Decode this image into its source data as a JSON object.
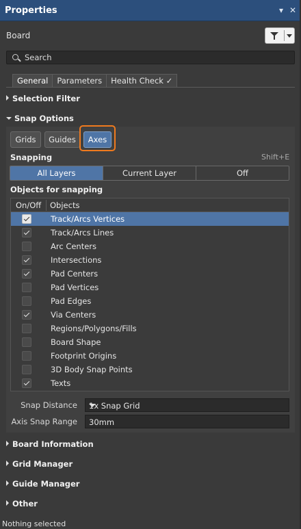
{
  "window": {
    "title": "Properties",
    "pin_glyph": "▾",
    "close_glyph": "✕"
  },
  "header": {
    "object_type": "Board",
    "filter_icon": "funnel-icon"
  },
  "search": {
    "placeholder": "Search",
    "value": ""
  },
  "tabs": [
    {
      "label": "General",
      "active": true
    },
    {
      "label": "Parameters",
      "active": false
    },
    {
      "label": "Health Check ✓",
      "active": false
    }
  ],
  "sections": {
    "selection_filter": "Selection Filter",
    "snap_options": "Snap Options",
    "board_information": "Board Information",
    "grid_manager": "Grid Manager",
    "guide_manager": "Guide Manager",
    "other": "Other"
  },
  "snap_options": {
    "buttons": [
      {
        "label": "Grids",
        "active": false
      },
      {
        "label": "Guides",
        "active": false
      },
      {
        "label": "Axes",
        "active": true
      }
    ],
    "snapping_label": "Snapping",
    "snapping_shortcut": "Shift+E",
    "layer_modes": [
      {
        "label": "All Layers",
        "active": true
      },
      {
        "label": "Current Layer",
        "active": false
      },
      {
        "label": "Off",
        "active": false
      }
    ],
    "objects_label": "Objects for snapping",
    "columns": [
      "On/Off",
      "Objects"
    ],
    "objects": [
      {
        "name": "Track/Arcs Vertices",
        "on": true,
        "selected": true
      },
      {
        "name": "Track/Arcs Lines",
        "on": true,
        "selected": false
      },
      {
        "name": "Arc Centers",
        "on": false,
        "selected": false
      },
      {
        "name": "Intersections",
        "on": true,
        "selected": false
      },
      {
        "name": "Pad Centers",
        "on": true,
        "selected": false
      },
      {
        "name": "Pad Vertices",
        "on": false,
        "selected": false
      },
      {
        "name": "Pad Edges",
        "on": false,
        "selected": false
      },
      {
        "name": "Via Centers",
        "on": true,
        "selected": false
      },
      {
        "name": "Regions/Polygons/Fills",
        "on": false,
        "selected": false
      },
      {
        "name": "Board Shape",
        "on": false,
        "selected": false
      },
      {
        "name": "Footprint Origins",
        "on": false,
        "selected": false
      },
      {
        "name": "3D Body Snap Points",
        "on": false,
        "selected": false
      },
      {
        "name": "Texts",
        "on": true,
        "selected": false
      }
    ],
    "snap_distance_label": "Snap Distance",
    "snap_distance_value": "1x Snap Grid",
    "axis_snap_range_label": "Axis Snap Range",
    "axis_snap_range_value": "30mm"
  },
  "status": {
    "text": "Nothing selected"
  },
  "colors": {
    "titlebar": "#2c4f7c",
    "accent": "#4f75a6",
    "highlight": "#f07a1e",
    "panel": "#3a3a3a"
  }
}
